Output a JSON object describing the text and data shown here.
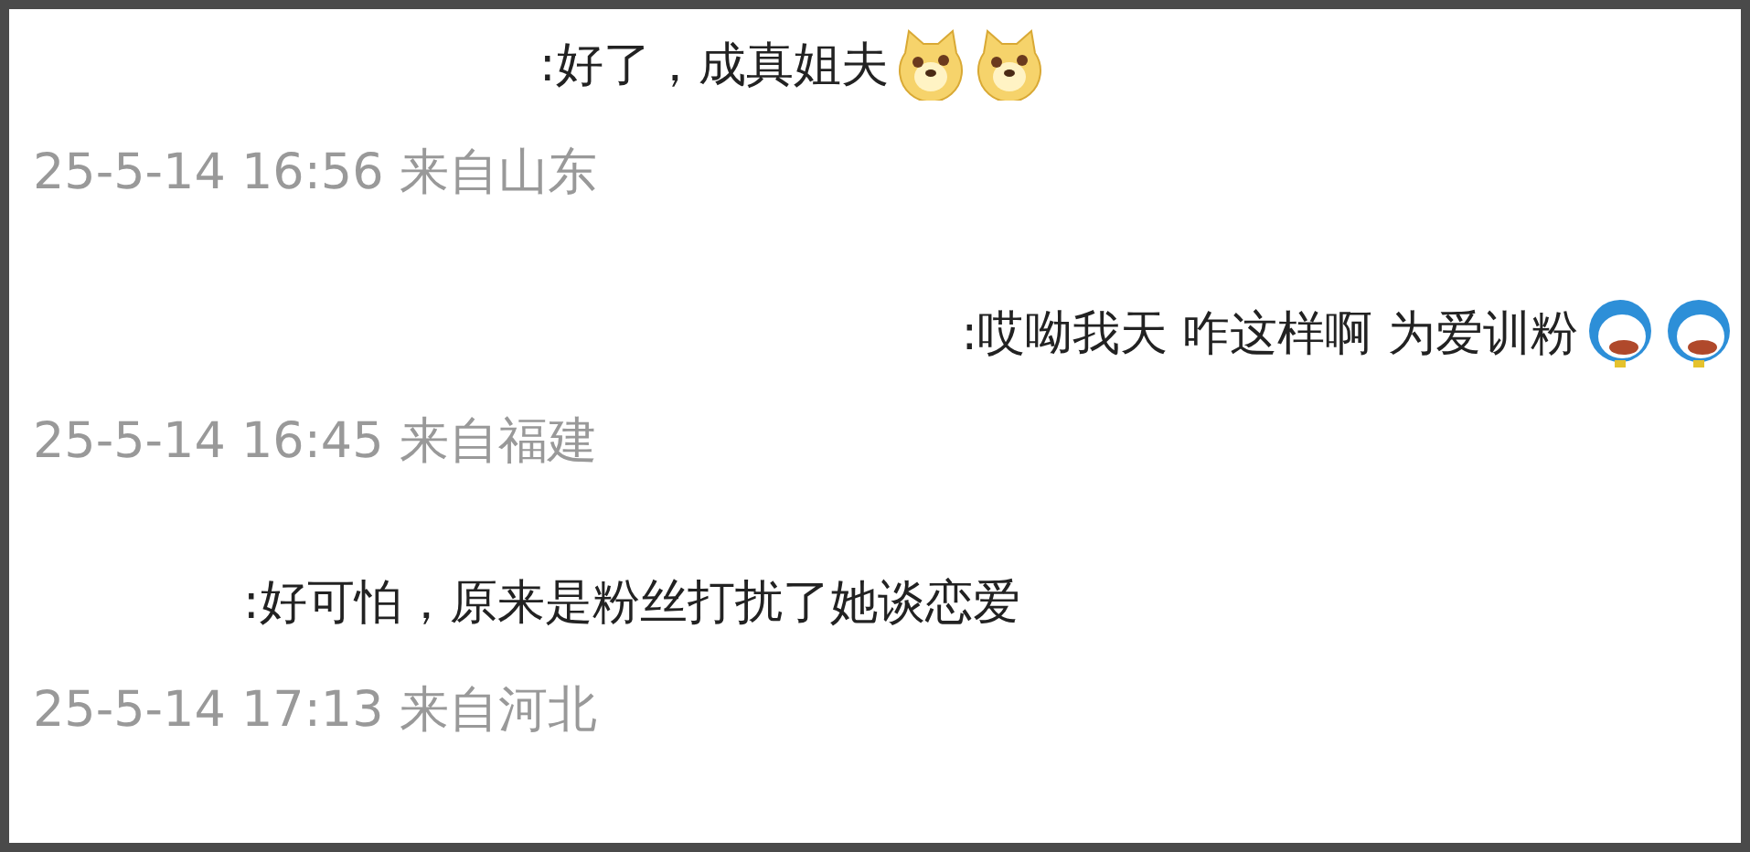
{
  "comments": [
    {
      "text": ":好了，成真姐夫",
      "emojis": [
        {
          "kind": "dog"
        },
        {
          "kind": "dog"
        }
      ],
      "meta": "25-5-14 16:56 来自山东"
    },
    {
      "text": ":哎呦我天 咋这样啊 为爱训粉",
      "emojis": [
        {
          "kind": "robot"
        },
        {
          "kind": "robot"
        }
      ],
      "meta": "25-5-14 16:45 来自福建"
    },
    {
      "text": ":好可怕，原来是粉丝打扰了她谈恋爱",
      "meta": "25-5-14 17:13 来自河北"
    }
  ]
}
